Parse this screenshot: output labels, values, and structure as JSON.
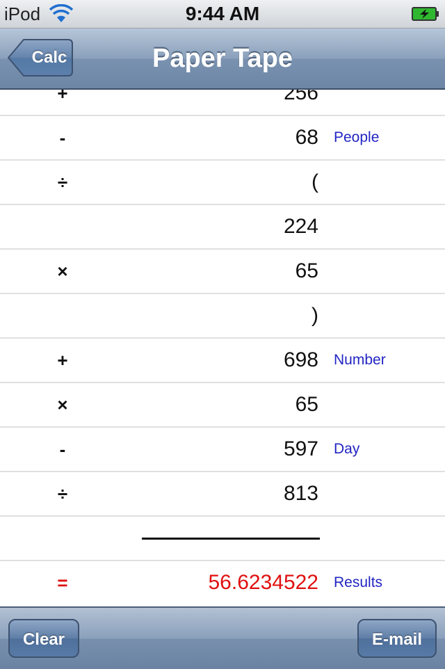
{
  "status_bar": {
    "carrier": "iPod",
    "time": "9:44 AM",
    "wifi_icon": "wifi-icon",
    "battery_icon": "battery-charging-icon"
  },
  "nav": {
    "back_label": "Calc",
    "title": "Paper Tape"
  },
  "tape": [
    {
      "op": "+",
      "value": "256",
      "note": ""
    },
    {
      "op": "-",
      "value": "68",
      "note": "People"
    },
    {
      "op": "÷",
      "value": "(",
      "note": ""
    },
    {
      "op": "",
      "value": "224",
      "note": ""
    },
    {
      "op": "×",
      "value": "65",
      "note": ""
    },
    {
      "op": "",
      "value": ")",
      "note": ""
    },
    {
      "op": "+",
      "value": "698",
      "note": "Number"
    },
    {
      "op": "×",
      "value": "65",
      "note": ""
    },
    {
      "op": "-",
      "value": "597",
      "note": "Day"
    },
    {
      "op": "÷",
      "value": "813",
      "note": ""
    }
  ],
  "result": {
    "op": "=",
    "value": "56.6234522",
    "note": "Results"
  },
  "toolbar": {
    "clear_label": "Clear",
    "email_label": "E-mail"
  },
  "colors": {
    "result": "#e01010",
    "note": "#2225c2",
    "nav": "#6d86a6"
  }
}
